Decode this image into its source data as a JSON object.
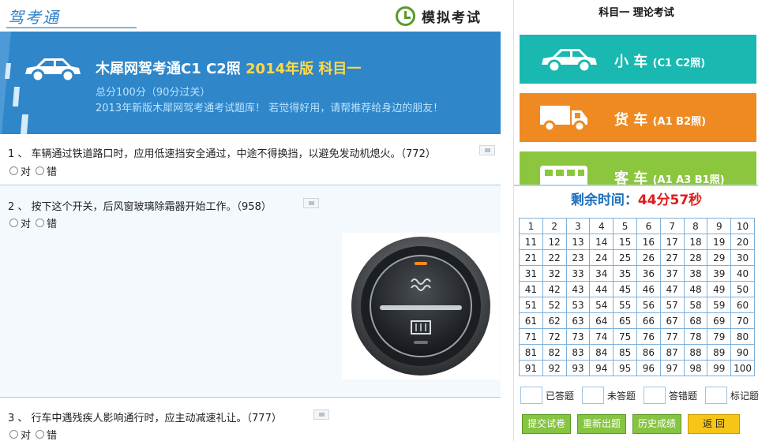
{
  "header": {
    "logo": "驾考通",
    "mode_label": "模拟考试"
  },
  "banner": {
    "title_main": "木犀网驾考通C1 C2照",
    "title_highlight": "2014年版 科目一",
    "score_text": "总分100分（90分过关）",
    "note": "2013年新版木犀网驾考通考试题库！ 若觉得好用，请帮推荐给身边的朋友！"
  },
  "questions": [
    {
      "text": "1 、 车辆通过铁道路口时，应用低速挡安全通过，中途不得换挡，以避免发动机熄火。（772）",
      "options": [
        "对",
        "错"
      ]
    },
    {
      "text": "2 、 按下这个开关，后风窗玻璃除霜器开始工作。（958）",
      "options": [
        "对",
        "错"
      ]
    },
    {
      "text": "3 、 行车中遇残疾人影响通行时，应主动减速礼让。（777）",
      "options": [
        "对",
        "错"
      ]
    }
  ],
  "sidebar": {
    "exam_title": "科目一  理论考试",
    "vehicles": [
      {
        "name": "小 车",
        "code": "(C1 C2照)",
        "color": "#19b8b0",
        "icon": "car-icon"
      },
      {
        "name": "货 车",
        "code": "(A1 B2照)",
        "color": "#ef8a22",
        "icon": "truck-icon"
      },
      {
        "name": "客 车",
        "code": "(A1 A3 B1照)",
        "color": "#8cc63f",
        "icon": "bus-icon"
      }
    ],
    "timer_label": "剩余时间：",
    "timer_value": "44分57秒",
    "legend": [
      "已答题",
      "未答题",
      "答错题",
      "标记题"
    ],
    "actions": [
      "提交试卷",
      "重新出题",
      "历史成绩",
      "返 回"
    ]
  },
  "colors": {
    "banner": "#2f86c9",
    "timer_value": "#e11b1b",
    "accent_blue": "#1e6fba"
  }
}
